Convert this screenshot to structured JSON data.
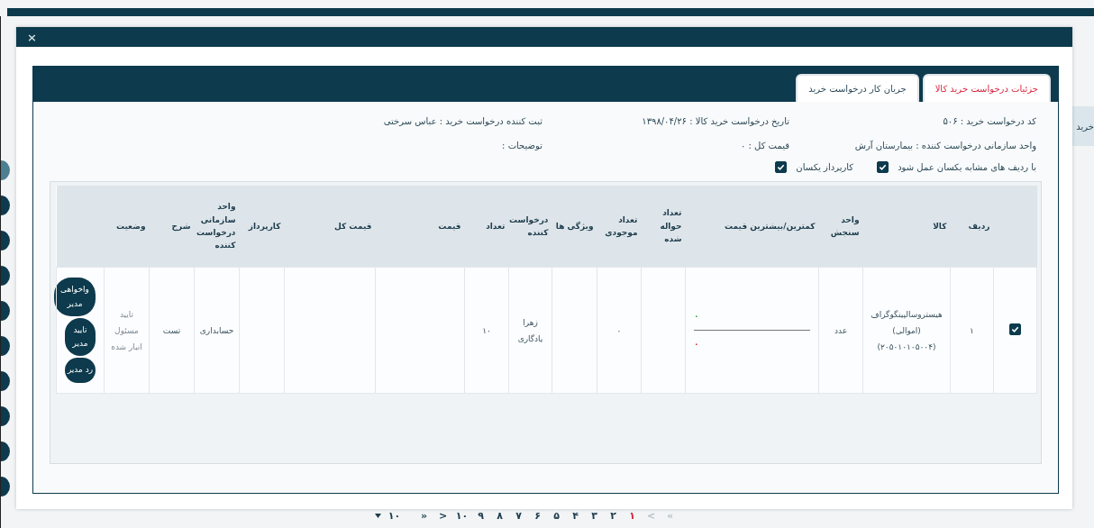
{
  "background_table": {
    "column_header": "خرید"
  },
  "modal": {
    "close": "×",
    "tabs": [
      {
        "label": "جزئیات درخواست خرید کالا",
        "selected": true
      },
      {
        "label": "جریان کار درخواست خرید",
        "selected": false
      }
    ],
    "fields": [
      {
        "text": "کد درخواست خرید : ۵۰۶"
      },
      {
        "text": "تاریخ درخواست خرید کالا : ۱۳۹۸/۰۴/۲۶"
      },
      {
        "text": "ثبت کننده درخواست خرید : عباس سرختی"
      },
      {
        "text": "واحد سازمانی درخواست کننده : بیمارستان آرش"
      },
      {
        "text": "قیمت کل : ۰"
      },
      {
        "text": "توضیحات :"
      }
    ],
    "options": [
      {
        "label": "با ردیف های مشابه یکسان عمل شود",
        "checked": true
      },
      {
        "label": "کارپرداز یکسان",
        "checked": true
      }
    ],
    "table": {
      "columns": [
        "",
        "ردیف",
        "کالا",
        "واحد سنجش",
        "کمترین/بیشترین قیمت",
        "تعداد حواله شده",
        "تعداد موجودی",
        "ویژگی ها",
        "درخواست کننده",
        "تعداد",
        "قیمت",
        "قیمت کل",
        "کارپرداز",
        "واحد سازمانی درخواست کننده",
        "شرح",
        "وضعیت",
        ""
      ],
      "rows": [
        {
          "checked": true,
          "row_number": "۱",
          "item": "هیستروسالپینگوگراف (اموالی) (۲۰۵۰۱۰۱۰۵۰۰۴)",
          "unit": "عدد",
          "min_price": "۰",
          "max_price": "۰",
          "issued_count": "",
          "stock_count": "۰",
          "features": "",
          "requester": "زهرا یادگاری",
          "count": "۱۰",
          "price": "",
          "total_price": "",
          "buyer": "",
          "department": "حسابداری",
          "description": "تست",
          "status": "تایید مسئول انبار شده",
          "actions": [
            "واخواهی مدیر",
            "تایید مدیر",
            "رد مدیر"
          ]
        }
      ]
    }
  },
  "pagination": {
    "first": {
      "label": "»",
      "disabled": true
    },
    "next": {
      "label": ">",
      "disabled": true
    },
    "pages": [
      {
        "label": "۱",
        "selected": true
      },
      {
        "label": "۲",
        "selected": false
      },
      {
        "label": "۳",
        "selected": false
      },
      {
        "label": "۴",
        "selected": false
      },
      {
        "label": "۵",
        "selected": false
      },
      {
        "label": "۶",
        "selected": false
      },
      {
        "label": "۷",
        "selected": false
      },
      {
        "label": "۸",
        "selected": false
      },
      {
        "label": "۹",
        "selected": false
      },
      {
        "label": "۱۰",
        "selected": false
      }
    ],
    "prev": {
      "label": "<",
      "disabled": false
    },
    "last": {
      "label": "«",
      "disabled": false
    },
    "page_size": "۱۰"
  }
}
